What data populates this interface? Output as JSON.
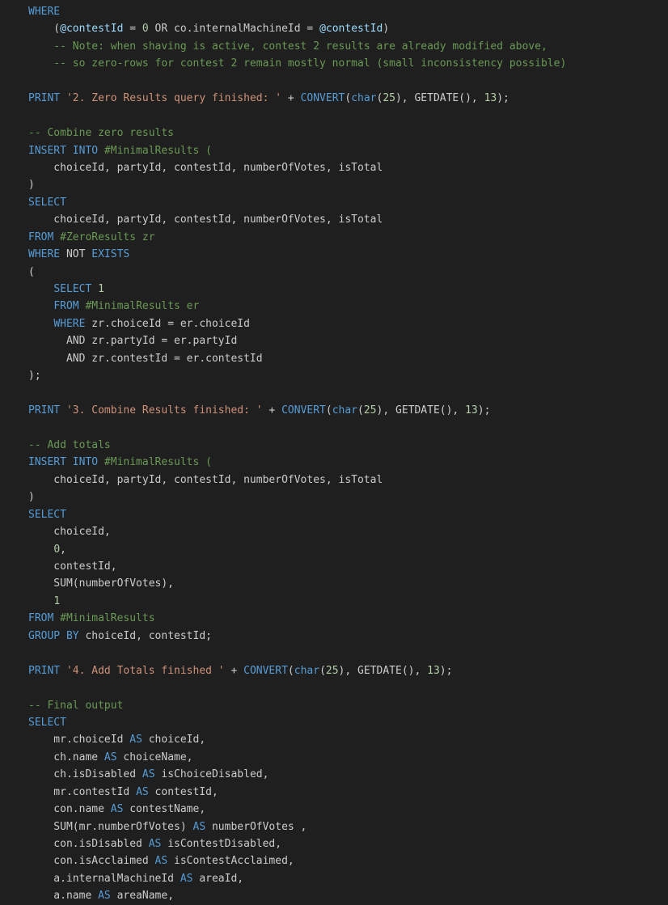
{
  "editor": {
    "language": "sql",
    "lines": [
      [
        {
          "t": "WHERE",
          "c": "kw"
        }
      ],
      [
        {
          "t": "    (",
          "c": "txt"
        },
        {
          "t": "@contestId",
          "c": "var"
        },
        {
          "t": " = ",
          "c": "txt"
        },
        {
          "t": "0",
          "c": "num"
        },
        {
          "t": " OR co.internalMachineId = ",
          "c": "txt"
        },
        {
          "t": "@contestId",
          "c": "var"
        },
        {
          "t": ")",
          "c": "txt"
        }
      ],
      [
        {
          "t": "    -- Note: when shaving is active, contest 2 results are already modified above,",
          "c": "cm"
        }
      ],
      [
        {
          "t": "    -- so zero-rows for contest 2 remain mostly normal (small inconsistency possible)",
          "c": "cm"
        }
      ],
      [],
      [
        {
          "t": "PRINT ",
          "c": "kw"
        },
        {
          "t": "'2. Zero Results query finished: '",
          "c": "str"
        },
        {
          "t": " + ",
          "c": "txt"
        },
        {
          "t": "CONVERT",
          "c": "kw"
        },
        {
          "t": "(",
          "c": "txt"
        },
        {
          "t": "char",
          "c": "kw"
        },
        {
          "t": "(",
          "c": "txt"
        },
        {
          "t": "25",
          "c": "num"
        },
        {
          "t": "), GETDATE(), ",
          "c": "txt"
        },
        {
          "t": "13",
          "c": "num"
        },
        {
          "t": ");",
          "c": "txt"
        }
      ],
      [],
      [
        {
          "t": "-- Combine zero results",
          "c": "cm"
        }
      ],
      [
        {
          "t": "INSERT INTO ",
          "c": "kw"
        },
        {
          "t": "#MinimalResults (",
          "c": "cm"
        }
      ],
      [
        {
          "t": "    choiceId, partyId, contestId, numberOfVotes, isTotal",
          "c": "txt"
        }
      ],
      [
        {
          "t": ")",
          "c": "txt"
        }
      ],
      [
        {
          "t": "SELECT",
          "c": "kw"
        }
      ],
      [
        {
          "t": "    choiceId, partyId, contestId, numberOfVotes, isTotal",
          "c": "txt"
        }
      ],
      [
        {
          "t": "FROM ",
          "c": "kw"
        },
        {
          "t": "#ZeroResults zr",
          "c": "cm"
        }
      ],
      [
        {
          "t": "WHERE ",
          "c": "kw"
        },
        {
          "t": "NOT ",
          "c": "txt"
        },
        {
          "t": "EXISTS",
          "c": "kw"
        }
      ],
      [
        {
          "t": "(",
          "c": "txt"
        }
      ],
      [
        {
          "t": "    ",
          "c": "txt"
        },
        {
          "t": "SELECT ",
          "c": "kw"
        },
        {
          "t": "1",
          "c": "num"
        }
      ],
      [
        {
          "t": "    ",
          "c": "txt"
        },
        {
          "t": "FROM ",
          "c": "kw"
        },
        {
          "t": "#MinimalResults er",
          "c": "cm"
        }
      ],
      [
        {
          "t": "    ",
          "c": "txt"
        },
        {
          "t": "WHERE ",
          "c": "kw"
        },
        {
          "t": "zr.choiceId = er.choiceId",
          "c": "txt"
        }
      ],
      [
        {
          "t": "      AND zr.partyId = er.partyId",
          "c": "txt"
        }
      ],
      [
        {
          "t": "      AND zr.contestId = er.contestId",
          "c": "txt"
        }
      ],
      [
        {
          "t": ");",
          "c": "txt"
        }
      ],
      [],
      [
        {
          "t": "PRINT ",
          "c": "kw"
        },
        {
          "t": "'3. Combine Results finished: '",
          "c": "str"
        },
        {
          "t": " + ",
          "c": "txt"
        },
        {
          "t": "CONVERT",
          "c": "kw"
        },
        {
          "t": "(",
          "c": "txt"
        },
        {
          "t": "char",
          "c": "kw"
        },
        {
          "t": "(",
          "c": "txt"
        },
        {
          "t": "25",
          "c": "num"
        },
        {
          "t": "), GETDATE(), ",
          "c": "txt"
        },
        {
          "t": "13",
          "c": "num"
        },
        {
          "t": ");",
          "c": "txt"
        }
      ],
      [],
      [
        {
          "t": "-- Add totals",
          "c": "cm"
        }
      ],
      [
        {
          "t": "INSERT INTO ",
          "c": "kw"
        },
        {
          "t": "#MinimalResults (",
          "c": "cm"
        }
      ],
      [
        {
          "t": "    choiceId, partyId, contestId, numberOfVotes, isTotal",
          "c": "txt"
        }
      ],
      [
        {
          "t": ")",
          "c": "txt"
        }
      ],
      [
        {
          "t": "SELECT",
          "c": "kw"
        }
      ],
      [
        {
          "t": "    choiceId,",
          "c": "txt"
        }
      ],
      [
        {
          "t": "    ",
          "c": "txt"
        },
        {
          "t": "0",
          "c": "num"
        },
        {
          "t": ",",
          "c": "txt"
        }
      ],
      [
        {
          "t": "    contestId,",
          "c": "txt"
        }
      ],
      [
        {
          "t": "    SUM(numberOfVotes),",
          "c": "txt"
        }
      ],
      [
        {
          "t": "    ",
          "c": "txt"
        },
        {
          "t": "1",
          "c": "num"
        }
      ],
      [
        {
          "t": "FROM ",
          "c": "kw"
        },
        {
          "t": "#MinimalResults",
          "c": "cm"
        }
      ],
      [
        {
          "t": "GROUP BY ",
          "c": "kw"
        },
        {
          "t": "choiceId, contestId;",
          "c": "txt"
        }
      ],
      [],
      [
        {
          "t": "PRINT ",
          "c": "kw"
        },
        {
          "t": "'4. Add Totals finished '",
          "c": "str"
        },
        {
          "t": " + ",
          "c": "txt"
        },
        {
          "t": "CONVERT",
          "c": "kw"
        },
        {
          "t": "(",
          "c": "txt"
        },
        {
          "t": "char",
          "c": "kw"
        },
        {
          "t": "(",
          "c": "txt"
        },
        {
          "t": "25",
          "c": "num"
        },
        {
          "t": "), GETDATE(), ",
          "c": "txt"
        },
        {
          "t": "13",
          "c": "num"
        },
        {
          "t": ");",
          "c": "txt"
        }
      ],
      [],
      [
        {
          "t": "-- Final output",
          "c": "cm"
        }
      ],
      [
        {
          "t": "SELECT",
          "c": "kw"
        }
      ],
      [
        {
          "t": "    mr.choiceId ",
          "c": "txt"
        },
        {
          "t": "AS ",
          "c": "kw"
        },
        {
          "t": "choiceId,",
          "c": "txt"
        }
      ],
      [
        {
          "t": "    ch.name ",
          "c": "txt"
        },
        {
          "t": "AS ",
          "c": "kw"
        },
        {
          "t": "choiceName,",
          "c": "txt"
        }
      ],
      [
        {
          "t": "    ch.isDisabled ",
          "c": "txt"
        },
        {
          "t": "AS ",
          "c": "kw"
        },
        {
          "t": "isChoiceDisabled,",
          "c": "txt"
        }
      ],
      [
        {
          "t": "    mr.contestId ",
          "c": "txt"
        },
        {
          "t": "AS ",
          "c": "kw"
        },
        {
          "t": "contestId,",
          "c": "txt"
        }
      ],
      [
        {
          "t": "    con.name ",
          "c": "txt"
        },
        {
          "t": "AS ",
          "c": "kw"
        },
        {
          "t": "contestName,",
          "c": "txt"
        }
      ],
      [
        {
          "t": "    SUM(mr.numberOfVotes) ",
          "c": "txt"
        },
        {
          "t": "AS ",
          "c": "kw"
        },
        {
          "t": "numberOfVotes ,",
          "c": "txt"
        }
      ],
      [
        {
          "t": "    con.isDisabled ",
          "c": "txt"
        },
        {
          "t": "AS ",
          "c": "kw"
        },
        {
          "t": "isContestDisabled,",
          "c": "txt"
        }
      ],
      [
        {
          "t": "    con.isAcclaimed ",
          "c": "txt"
        },
        {
          "t": "AS ",
          "c": "kw"
        },
        {
          "t": "isContestAcclaimed,",
          "c": "txt"
        }
      ],
      [
        {
          "t": "    a.internalMachineId ",
          "c": "txt"
        },
        {
          "t": "AS ",
          "c": "kw"
        },
        {
          "t": "areaId,",
          "c": "txt"
        }
      ],
      [
        {
          "t": "    a.name ",
          "c": "txt"
        },
        {
          "t": "AS ",
          "c": "kw"
        },
        {
          "t": "areaName,",
          "c": "txt"
        }
      ]
    ]
  }
}
